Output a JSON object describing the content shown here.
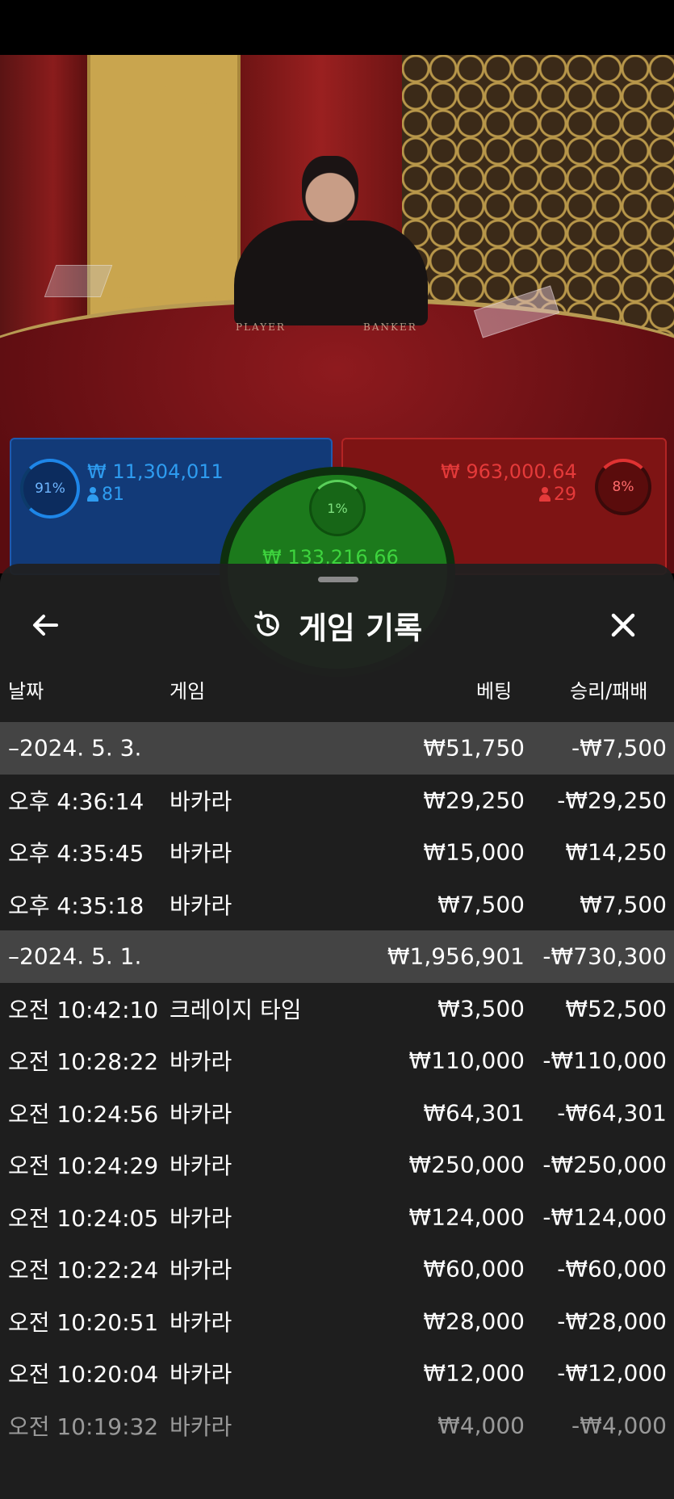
{
  "scene": {
    "table_left_label": "PLAYER",
    "table_right_label": "BANKER"
  },
  "bets": {
    "player": {
      "percent": "91%",
      "amount": "₩ 11,304,011",
      "count": "81",
      "color": "#2e9cf0"
    },
    "tie": {
      "percent": "1%",
      "amount": "₩ 133,216.66",
      "color": "#3ed43e"
    },
    "banker": {
      "percent": "8%",
      "amount": "₩ 963,000.64",
      "count": "29",
      "color": "#e53a3a"
    }
  },
  "sheet": {
    "title": "게임 기록",
    "title_icon": "history-icon",
    "back_icon": "arrow-left-icon",
    "close_icon": "close-icon",
    "columns": {
      "date": "날짜",
      "game": "게임",
      "bet": "베팅",
      "result": "승리/패배"
    },
    "rows": [
      {
        "type": "group",
        "date": "–2024. 5. 3.",
        "game": "",
        "bet": "₩51,750",
        "result": "-₩7,500"
      },
      {
        "type": "item",
        "date": "오후 4:36:14",
        "game": "바카라",
        "bet": "₩29,250",
        "result": "-₩29,250"
      },
      {
        "type": "item",
        "date": "오후 4:35:45",
        "game": "바카라",
        "bet": "₩15,000",
        "result": "₩14,250"
      },
      {
        "type": "item",
        "date": "오후 4:35:18",
        "game": "바카라",
        "bet": "₩7,500",
        "result": "₩7,500"
      },
      {
        "type": "group",
        "date": "–2024. 5. 1.",
        "game": "",
        "bet": "₩1,956,901",
        "result": "-₩730,300"
      },
      {
        "type": "item",
        "date": "오전 10:42:10",
        "game": "크레이지 타임",
        "bet": "₩3,500",
        "result": "₩52,500"
      },
      {
        "type": "item",
        "date": "오전 10:28:22",
        "game": "바카라",
        "bet": "₩110,000",
        "result": "-₩110,000"
      },
      {
        "type": "item",
        "date": "오전 10:24:56",
        "game": "바카라",
        "bet": "₩64,301",
        "result": "-₩64,301"
      },
      {
        "type": "item",
        "date": "오전 10:24:29",
        "game": "바카라",
        "bet": "₩250,000",
        "result": "-₩250,000"
      },
      {
        "type": "item",
        "date": "오전 10:24:05",
        "game": "바카라",
        "bet": "₩124,000",
        "result": "-₩124,000"
      },
      {
        "type": "item",
        "date": "오전 10:22:24",
        "game": "바카라",
        "bet": "₩60,000",
        "result": "-₩60,000"
      },
      {
        "type": "item",
        "date": "오전 10:20:51",
        "game": "바카라",
        "bet": "₩28,000",
        "result": "-₩28,000"
      },
      {
        "type": "item",
        "date": "오전 10:20:04",
        "game": "바카라",
        "bet": "₩12,000",
        "result": "-₩12,000"
      },
      {
        "type": "item",
        "date": "오전 10:19:32",
        "game": "바카라",
        "bet": "₩4,000",
        "result": "-₩4,000"
      }
    ]
  }
}
